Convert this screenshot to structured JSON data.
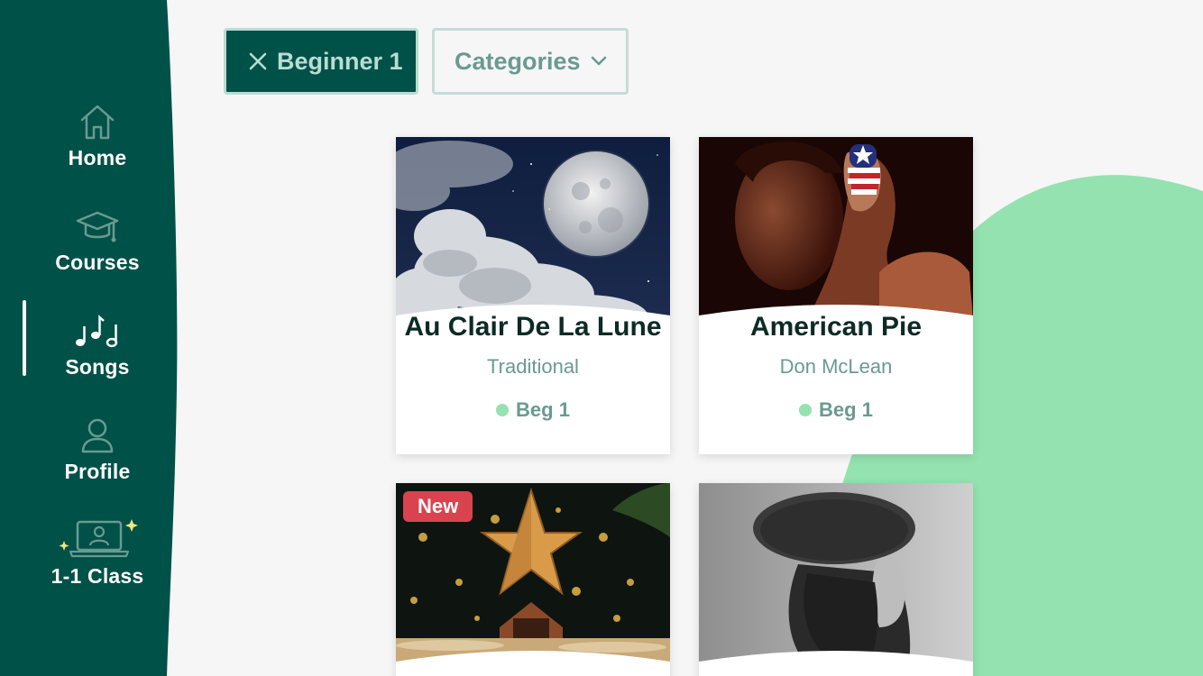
{
  "sidebar": {
    "items": [
      {
        "label": "Home",
        "icon": "home-icon"
      },
      {
        "label": "Courses",
        "icon": "graduation-cap-icon"
      },
      {
        "label": "Songs",
        "icon": "music-notes-icon",
        "active": true
      },
      {
        "label": "Profile",
        "icon": "person-icon"
      },
      {
        "label": "1-1 Class",
        "icon": "laptop-video-icon"
      }
    ]
  },
  "filters": {
    "active_level": "Beginner 1",
    "categories_label": "Categories"
  },
  "songs": [
    {
      "title": "Au Clair De La Lune",
      "artist": "Traditional",
      "level": "Beg 1"
    },
    {
      "title": "American Pie",
      "artist": "Don McLean",
      "level": "Beg 1"
    },
    {
      "badge": "New"
    },
    {}
  ],
  "colors": {
    "sidebar": "#005148",
    "accent_green": "#94e2b0",
    "muted_teal": "#6a9a91",
    "badge_red": "#d9434f"
  }
}
